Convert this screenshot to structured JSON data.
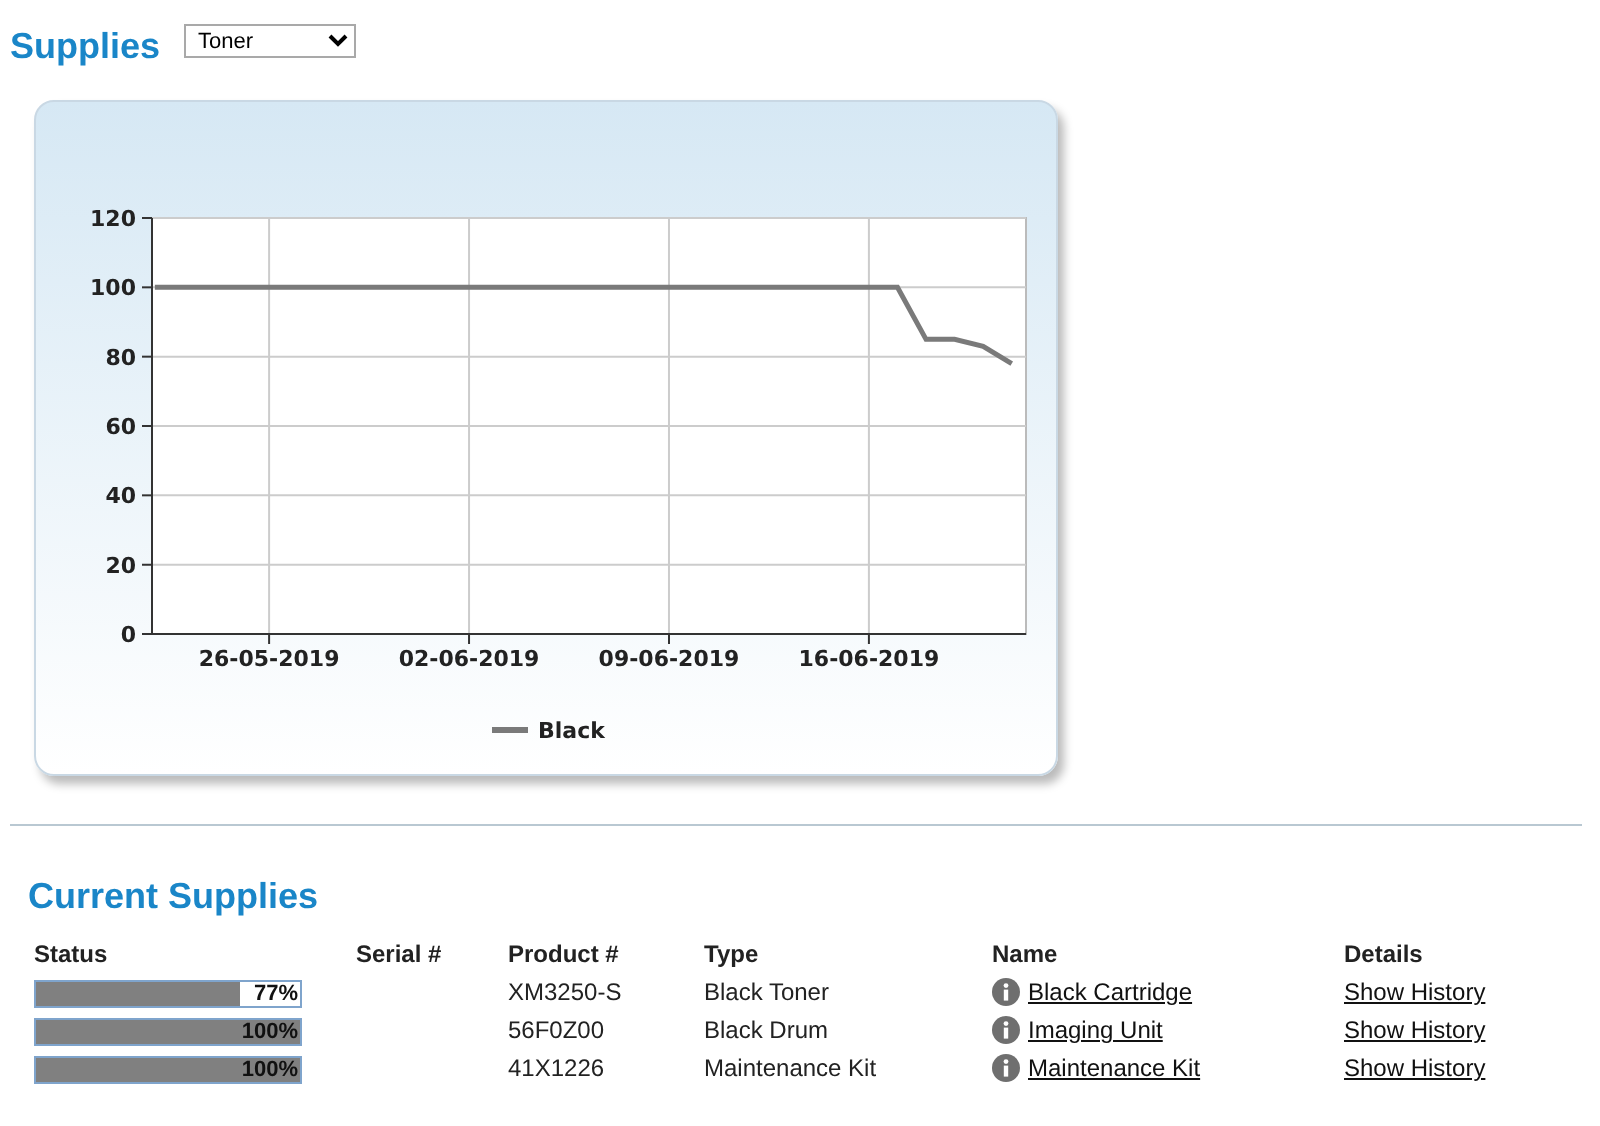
{
  "header": {
    "title": "Supplies",
    "dropdown": {
      "value": "Toner"
    }
  },
  "history_chart": {
    "chart_data": {
      "type": "line",
      "categories": [
        null,
        null,
        null,
        null,
        "26-05-2019",
        null,
        null,
        null,
        null,
        null,
        null,
        "02-06-2019",
        null,
        null,
        null,
        null,
        null,
        null,
        "09-06-2019",
        null,
        null,
        null,
        null,
        null,
        null,
        "16-06-2019",
        null,
        null,
        null,
        null,
        null
      ],
      "series": [
        {
          "name": "Black",
          "color": "#7a7a7a",
          "values": [
            100,
            100,
            100,
            100,
            100,
            100,
            100,
            100,
            100,
            100,
            100,
            100,
            100,
            100,
            100,
            100,
            100,
            100,
            100,
            100,
            100,
            100,
            100,
            100,
            100,
            100,
            100,
            85,
            85,
            83,
            78
          ]
        }
      ],
      "grid": true,
      "ylim": [
        0,
        120
      ],
      "yticks": [
        0,
        20,
        40,
        60,
        80,
        100,
        120
      ]
    }
  },
  "current_supplies": {
    "title": "Current Supplies",
    "columns": [
      "Status",
      "Serial #",
      "Product #",
      "Type",
      "Name",
      "Details"
    ],
    "rows": [
      {
        "level": 0.77,
        "reading": "77%",
        "product": "XM3250-S",
        "type": "Black Toner",
        "name": "Black Cartridge",
        "details": "Show History"
      },
      {
        "level": 1,
        "reading": "100%",
        "product": "56F0Z00",
        "type": "Black Drum",
        "name": "Imaging Unit",
        "details": "Show History"
      },
      {
        "level": 1,
        "reading": "100%",
        "product": "41X1226",
        "type": "Maintenance Kit",
        "name": "Maintenance Kit",
        "details": "Show History"
      }
    ]
  }
}
